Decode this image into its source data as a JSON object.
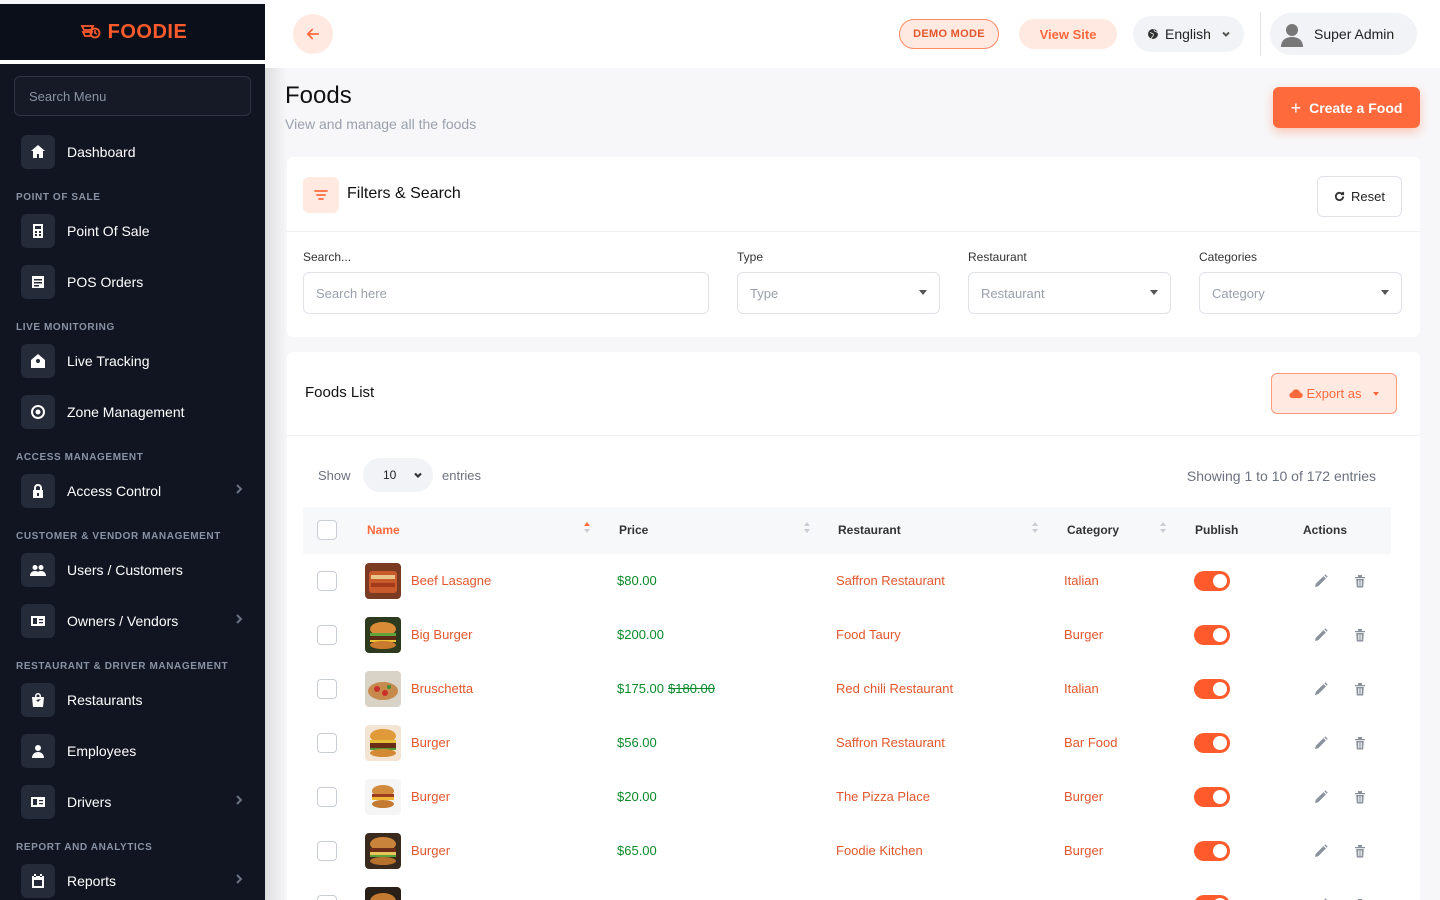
{
  "brand": {
    "name": "FOODIE",
    "accent": "#ff6a3d"
  },
  "sidebar": {
    "search_placeholder": "Search Menu",
    "items": [
      {
        "type": "item",
        "label": "Dashboard",
        "icon": "home-icon"
      },
      {
        "type": "section",
        "label": "POINT OF SALE"
      },
      {
        "type": "item",
        "label": "Point Of Sale",
        "icon": "calculator-icon"
      },
      {
        "type": "item",
        "label": "POS Orders",
        "icon": "receipt-icon"
      },
      {
        "type": "section",
        "label": "LIVE MONITORING"
      },
      {
        "type": "item",
        "label": "Live Tracking",
        "icon": "tracking-icon"
      },
      {
        "type": "item",
        "label": "Zone Management",
        "icon": "target-icon"
      },
      {
        "type": "section",
        "label": "ACCESS MANAGEMENT"
      },
      {
        "type": "item",
        "label": "Access Control",
        "icon": "lock-icon",
        "chevron": true
      },
      {
        "type": "section",
        "label": "CUSTOMER & VENDOR MANAGEMENT"
      },
      {
        "type": "item",
        "label": "Users / Customers",
        "icon": "users-icon"
      },
      {
        "type": "item",
        "label": "Owners / Vendors",
        "icon": "id-card-icon",
        "chevron": true
      },
      {
        "type": "section",
        "label": "RESTAURANT & DRIVER MANAGEMENT"
      },
      {
        "type": "item",
        "label": "Restaurants",
        "icon": "store-bag-icon"
      },
      {
        "type": "item",
        "label": "Employees",
        "icon": "person-icon"
      },
      {
        "type": "item",
        "label": "Drivers",
        "icon": "id-card-icon",
        "chevron": true
      },
      {
        "type": "section",
        "label": "REPORT AND ANALYTICS"
      },
      {
        "type": "item",
        "label": "Reports",
        "icon": "calendar-icon",
        "chevron": true
      }
    ]
  },
  "header": {
    "demo_label": "DEMO MODE",
    "view_site_label": "View Site",
    "language": "English",
    "user_name": "Super Admin"
  },
  "page": {
    "title": "Foods",
    "subtitle": "View and manage all the foods",
    "create_label": "Create a Food"
  },
  "filters": {
    "title": "Filters & Search",
    "reset_label": "Reset",
    "search_label": "Search...",
    "search_placeholder": "Search here",
    "type_label": "Type",
    "type_value": "Type",
    "restaurant_label": "Restaurant",
    "restaurant_value": "Restaurant",
    "categories_label": "Categories",
    "categories_value": "Category"
  },
  "list": {
    "title": "Foods List",
    "export_label": "Export as",
    "show_label": "Show",
    "entries_value": "10",
    "entries_label": "entries",
    "showing_text": "Showing 1 to 10 of 172 entries",
    "columns": {
      "name": "Name",
      "price": "Price",
      "restaurant": "Restaurant",
      "category": "Category",
      "publish": "Publish",
      "actions": "Actions"
    },
    "rows": [
      {
        "name": "Beef Lasagne",
        "price": "$80.00",
        "old_price": "",
        "restaurant": "Saffron Restaurant",
        "category": "Italian",
        "published": true
      },
      {
        "name": "Big Burger",
        "price": "$200.00",
        "old_price": "",
        "restaurant": "Food Taury",
        "category": "Burger",
        "published": true
      },
      {
        "name": "Bruschetta",
        "price": "$175.00",
        "old_price": "$180.00",
        "restaurant": "Red chili Restaurant",
        "category": "Italian",
        "published": true
      },
      {
        "name": "Burger",
        "price": "$56.00",
        "old_price": "",
        "restaurant": "Saffron Restaurant",
        "category": "Bar Food",
        "published": true
      },
      {
        "name": "Burger",
        "price": "$20.00",
        "old_price": "",
        "restaurant": "The Pizza Place",
        "category": "Burger",
        "published": true
      },
      {
        "name": "Burger",
        "price": "$65.00",
        "old_price": "",
        "restaurant": "Foodie Kitchen",
        "category": "Burger",
        "published": true
      },
      {
        "name": "",
        "price": "",
        "old_price": "",
        "restaurant": "",
        "category": "",
        "published": true
      }
    ]
  }
}
